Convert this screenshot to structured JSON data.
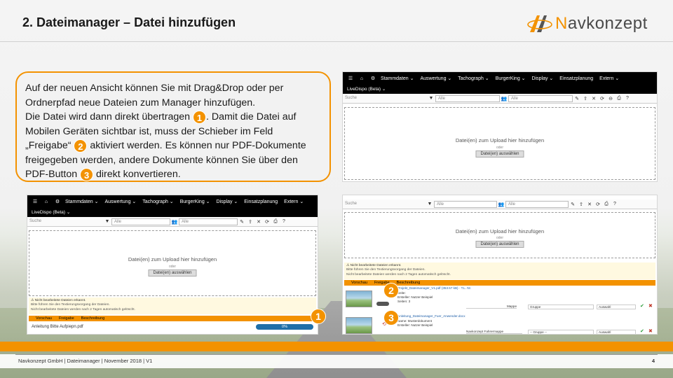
{
  "slide": {
    "title": "2. Dateimanager – Datei hinzufügen",
    "logo_prefix": "N",
    "logo_rest": "avkonzept",
    "footer": "Navkonzept GmbH  |  Dateimanager  |  November 2018  |  V1",
    "page": "4",
    "accent": "#f39200"
  },
  "callout": {
    "line1": "Auf der neuen Ansicht können Sie mit Drag&Drop oder per Ordnerpfad neue Dateien zum Manager hinzufügen.",
    "line2a": "Die Datei wird dann direkt übertragen ",
    "badge1": "1",
    "line2b": ". Damit die Datei auf Mobilen Geräten sichtbar ist, muss der Schieber im Feld „Freigabe“ ",
    "badge2": "2",
    "line2c": " aktiviert werden. Es können nur PDF-Dokumente freigegeben werden, andere Dokumente können Sie über den PDF-Button ",
    "badge3": "3",
    "line2d": " direkt konvertieren."
  },
  "app": {
    "nav": [
      "Stammdaten ⌄",
      "Auswertung ⌄",
      "Tachograph ⌄",
      "BurgerKing ⌄",
      "Display ⌄",
      "Einsatzplanung",
      "Extern ⌄"
    ],
    "subtitle": "LiveDispo (Beta) ⌄",
    "search_placeholder": "Suche",
    "filter1": "Alle",
    "filter2": "Alle",
    "drop_text": "Datei(en) zum Upload hier hinzufügen",
    "drop_or": "oder",
    "drop_button": "Datei(en) auswählen",
    "warn_title": "⚠ Nicht bearbeitete Dateien erkannt.",
    "warn_line1": "Bitte führen Sie den Textierungsvorgang der Dateien.",
    "warn_line2": "Nicht bearbeitete Dateien werden nach 2 Tagen automatisch gelöscht.",
    "col_preview": "Vorschau",
    "col_share": "Freigabe",
    "col_desc": "Beschreibung",
    "upload_file": "Anleitung Bitte Aufpiepn.pdf",
    "upload_pct": "0%",
    "file1_name": "Projekt_Dateimanager_V1.pdf (353.57 kB) · T.L. Nr.",
    "file1_meta1": "Seite: ",
    "file1_meta2": "Ersteller: Nutzer Beispiel",
    "file1_meta3": "Seiten: 3",
    "file1_type": "Mappe",
    "file1_group": "Gruppe",
    "file1_select": "Auswahl",
    "file2_name": "Anleitung_Dateimanager_Fuer_Anwender.docx",
    "file2_meta1": "Name: Musterdokument",
    "file2_meta2": "Ersteller: Nutzer Beispiel",
    "file2_type": "Navkonzept Fahrermappe",
    "file2_group": "-- Gruppe --",
    "file2_select": "Auswahl"
  },
  "markers": [
    "1",
    "2",
    "3"
  ]
}
